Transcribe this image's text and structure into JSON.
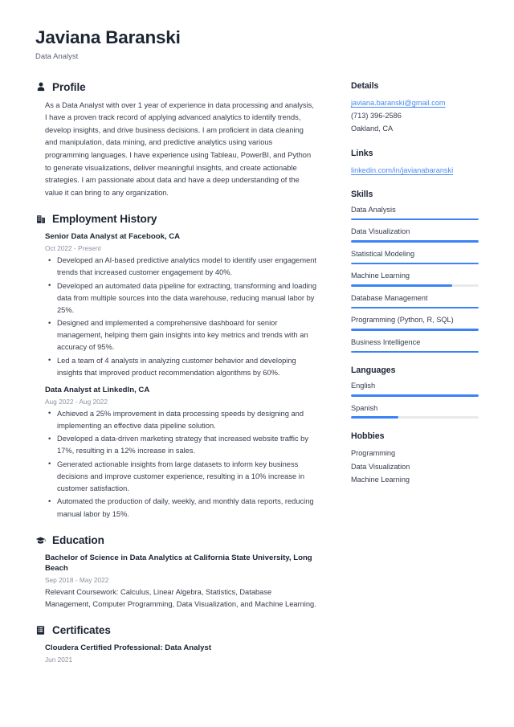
{
  "accent_color": "#3b82f6",
  "link_color": "#4a8bf0",
  "text_color": "#343b4c",
  "heading_color": "#1d2433",
  "muted_color": "#8c919e",
  "header": {
    "name": "Javiana Baranski",
    "title": "Data Analyst"
  },
  "sections": {
    "profile": {
      "icon": "user-icon",
      "title": "Profile",
      "body": "As a Data Analyst with over 1 year of experience in data processing and analysis, I have a proven track record of applying advanced analytics to identify trends, develop insights, and drive business decisions. I am proficient in data cleaning and manipulation, data mining, and predictive analytics using various programming languages. I have experience using Tableau, PowerBI, and Python to generate visualizations, deliver meaningful insights, and create actionable strategies. I am passionate about data and have a deep understanding of the value it can bring to any organization."
    },
    "employment": {
      "icon": "briefcase-icon",
      "title": "Employment History",
      "entries": [
        {
          "title": "Senior Data Analyst at Facebook, CA",
          "date": "Oct 2022 - Present",
          "bullets": [
            "Developed an AI-based predictive analytics model to identify user engagement trends that increased customer engagement by 40%.",
            "Developed an automated data pipeline for extracting, transforming and loading data from multiple sources into the data warehouse, reducing manual labor by 25%.",
            "Designed and implemented a comprehensive dashboard for senior management, helping them gain insights into key metrics and trends with an accuracy of 95%.",
            "Led a team of 4 analysts in analyzing customer behavior and developing insights that improved product recommendation algorithms by 60%."
          ]
        },
        {
          "title": "Data Analyst at LinkedIn, CA",
          "date": "Aug 2022 - Aug 2022",
          "bullets": [
            "Achieved a 25% improvement in data processing speeds by designing and implementing an effective data pipeline solution.",
            "Developed a data-driven marketing strategy that increased website traffic by 17%, resulting in a 12% increase in sales.",
            "Generated actionable insights from large datasets to inform key business decisions and improve customer experience, resulting in a 10% increase in customer satisfaction.",
            "Automated the production of daily, weekly, and monthly data reports, reducing manual labor by 15%."
          ]
        }
      ]
    },
    "education": {
      "icon": "graduation-cap-icon",
      "title": "Education",
      "entries": [
        {
          "title": "Bachelor of Science in Data Analytics at California State University, Long Beach",
          "date": "Sep 2018 - May 2022",
          "desc": "Relevant Coursework: Calculus, Linear Algebra, Statistics, Database Management, Computer Programming, Data Visualization, and Machine Learning."
        }
      ]
    },
    "certificates": {
      "icon": "clipboard-icon",
      "title": "Certificates",
      "entries": [
        {
          "title": "Cloudera Certified Professional: Data Analyst",
          "date": "Jun 2021"
        }
      ]
    }
  },
  "sidebar": {
    "details": {
      "title": "Details",
      "email": "javiana.baranski@gmail.com",
      "phone": "(713) 396-2586",
      "location": "Oakland, CA"
    },
    "links": {
      "title": "Links",
      "items": [
        {
          "label": "linkedin.com/in/javianabaranski"
        }
      ]
    },
    "skills": {
      "title": "Skills",
      "items": [
        {
          "label": "Data Analysis",
          "level": 100
        },
        {
          "label": "Data Visualization",
          "level": 100
        },
        {
          "label": "Statistical Modeling",
          "level": 100
        },
        {
          "label": "Machine Learning",
          "level": 79
        },
        {
          "label": "Database Management",
          "level": 100
        },
        {
          "label": "Programming (Python, R, SQL)",
          "level": 100
        },
        {
          "label": "Business Intelligence",
          "level": 100
        }
      ]
    },
    "languages": {
      "title": "Languages",
      "items": [
        {
          "label": "English",
          "level": 100
        },
        {
          "label": "Spanish",
          "level": 37
        }
      ]
    },
    "hobbies": {
      "title": "Hobbies",
      "items": [
        {
          "label": "Programming"
        },
        {
          "label": "Data Visualization"
        },
        {
          "label": "Machine Learning"
        }
      ]
    }
  }
}
